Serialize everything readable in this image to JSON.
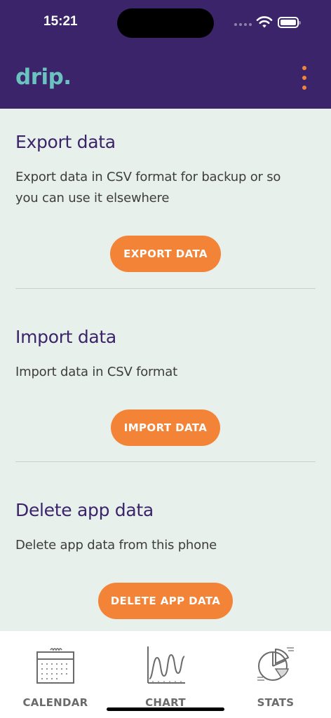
{
  "status": {
    "time": "15:21"
  },
  "app": {
    "logo": "drip."
  },
  "sections": [
    {
      "title": "Export data",
      "description_lines": [
        "Export data in CSV format for backup or so",
        "you can use it elsewhere"
      ],
      "button": "EXPORT DATA"
    },
    {
      "title": "Import data",
      "description_lines": [
        "Import data in CSV format"
      ],
      "button": "IMPORT DATA"
    },
    {
      "title": "Delete app data",
      "description_lines": [
        "Delete app data from this phone"
      ],
      "button": "DELETE APP DATA"
    }
  ],
  "tabs": [
    {
      "label": "CALENDAR",
      "icon": "calendar-icon"
    },
    {
      "label": "CHART",
      "icon": "chart-icon"
    },
    {
      "label": "STATS",
      "icon": "stats-icon"
    }
  ],
  "colors": {
    "brand": "#3b246a",
    "accent": "#f38337",
    "logo": "#6ac3c1",
    "background": "#e8f0ec"
  }
}
